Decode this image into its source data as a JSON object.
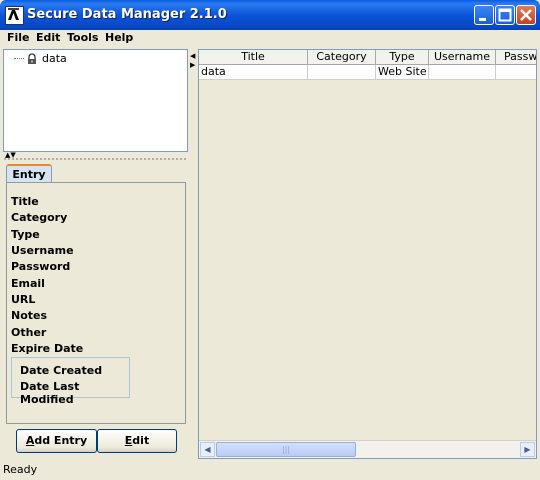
{
  "window": {
    "title": "Secure Data Manager 2.1.0"
  },
  "menu": {
    "items": [
      "File",
      "Edit",
      "Tools",
      "Help"
    ]
  },
  "tree": {
    "root_label": "data"
  },
  "tabs": {
    "entry_label": "Entry"
  },
  "entry_fields": [
    "Title",
    "Category",
    "Type",
    "Username",
    "Password",
    "Email",
    "URL",
    "Notes",
    "Other",
    "Expire Date"
  ],
  "date_fields": [
    "Date Created",
    "Date Last Modified"
  ],
  "buttons": {
    "add_entry_underlined": "A",
    "add_entry_rest": "dd Entry",
    "edit_underlined": "E",
    "edit_rest": "dit"
  },
  "table": {
    "columns": [
      "Title",
      "Category",
      "Type",
      "Username",
      "Passw"
    ],
    "rows": [
      [
        "data",
        "",
        "Web Site",
        "",
        ""
      ]
    ]
  },
  "status": "Ready",
  "colors": {
    "titlebar": "#0c54d8",
    "tab_accent": "#e68b2c",
    "window_bg": "#ece9d8"
  },
  "icons": {
    "app": "app-logo-icon",
    "tree_node": "lock-icon"
  }
}
